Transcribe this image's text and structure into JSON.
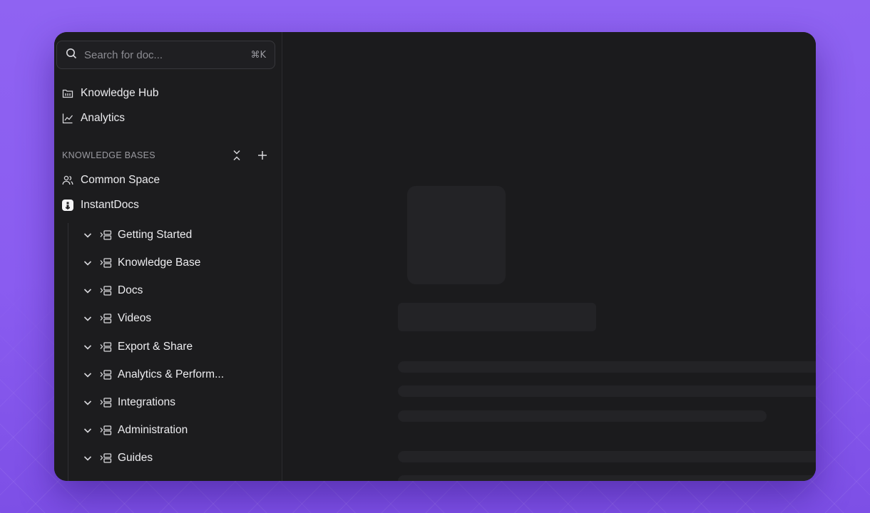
{
  "search": {
    "placeholder": "Search for doc...",
    "shortcut": "⌘K",
    "icon": "search-icon"
  },
  "nav": [
    {
      "label": "Knowledge Hub",
      "icon": "knowledge-hub-icon"
    },
    {
      "label": "Analytics",
      "icon": "analytics-chart-icon"
    }
  ],
  "knowledge_bases": {
    "title": "KNOWLEDGE BASES",
    "collapse_icon": "collapse-all-icon",
    "add_icon": "plus-icon",
    "items": [
      {
        "label": "Common Space",
        "icon": "users-icon"
      },
      {
        "label": "InstantDocs",
        "icon": "instantdocs-logo-icon"
      }
    ]
  },
  "tree": [
    {
      "label": "Getting Started"
    },
    {
      "label": "Knowledge Base"
    },
    {
      "label": "Docs"
    },
    {
      "label": "Videos"
    },
    {
      "label": "Export & Share"
    },
    {
      "label": "Analytics & Perform..."
    },
    {
      "label": "Integrations"
    },
    {
      "label": "Administration"
    },
    {
      "label": "Guides"
    }
  ],
  "colors": {
    "background": "#8a5cf0",
    "window": "#1a1a1c",
    "sidebar": "#1c1c1e",
    "skeleton": "#232326"
  }
}
